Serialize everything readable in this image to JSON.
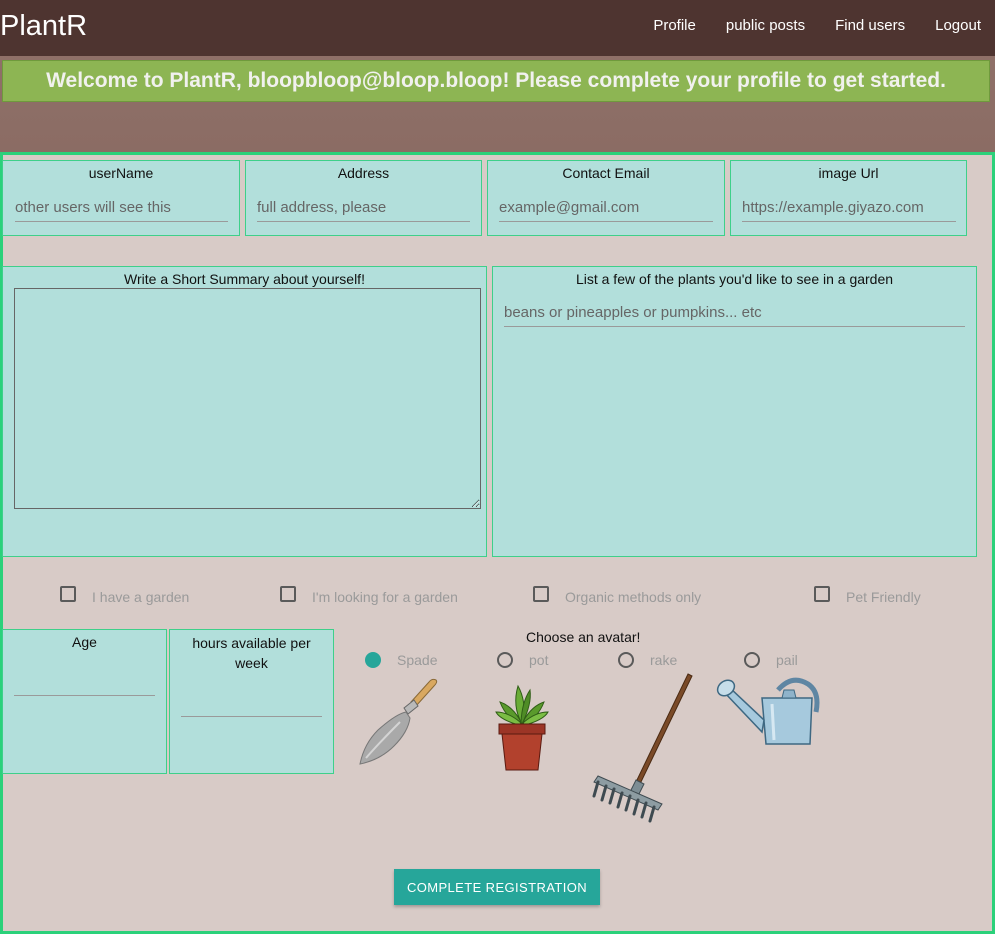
{
  "nav": {
    "brand": "PlantR",
    "links": [
      "Profile",
      "public posts",
      "Find users",
      "Logout"
    ]
  },
  "banner": {
    "text": "Welcome to PlantR, bloopbloop@bloop.bloop! Please complete your profile to get started."
  },
  "fields": {
    "username": {
      "label": "userName",
      "placeholder": "other users will see this"
    },
    "address": {
      "label": "Address",
      "placeholder": "full address, please"
    },
    "contact_email": {
      "label": "Contact Email",
      "placeholder": "example@gmail.com"
    },
    "image_url": {
      "label": "image Url",
      "placeholder": "https://example.giyazo.com"
    },
    "summary": {
      "label": "Write a Short Summary about yourself!"
    },
    "plants": {
      "label": "List a few of the plants you'd like to see in a garden",
      "placeholder": "beans or pineapples or pumpkins... etc"
    },
    "age": {
      "label": "Age"
    },
    "hours": {
      "label": "hours available per week"
    }
  },
  "checkboxes": [
    "I have a garden",
    "I'm looking for a garden",
    "Organic methods only",
    "Pet Friendly"
  ],
  "avatar": {
    "title": "Choose an avatar!",
    "options": [
      "Spade",
      "pot",
      "rake",
      "pail"
    ],
    "selected": "Spade"
  },
  "submit_label": "COMPLETE REGISTRATION",
  "colors": {
    "navbar": "#4e3430",
    "banner": "#8db553",
    "field_bg": "#b2dfdb",
    "field_border": "#3ed08a",
    "accent": "#26a69a",
    "page_bg": "#d8cbc7"
  }
}
